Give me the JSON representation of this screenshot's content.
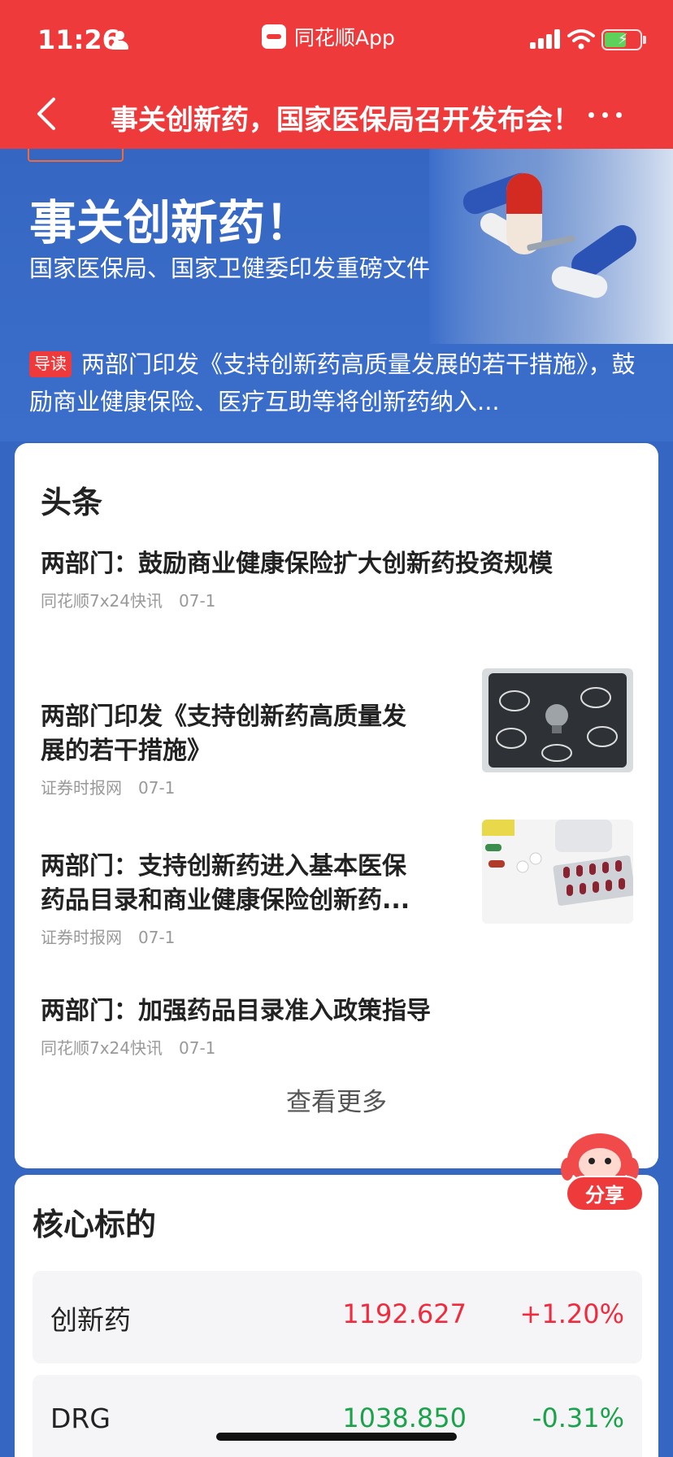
{
  "status": {
    "time": "11:26",
    "app_name": "同花顺App"
  },
  "nav": {
    "title": "事关创新药，国家医保局召开发布会！"
  },
  "hero": {
    "title": "事关创新药！",
    "subtitle": "国家医保局、国家卫健委印发重磅文件",
    "intro_badge": "导读",
    "intro_text": "两部门印发《支持创新药高质量发展的若干措施》，鼓励商业健康保险、医疗互助等将创新药纳入..."
  },
  "headlines": {
    "title": "头条",
    "items": [
      {
        "title": "两部门：鼓励商业健康保险扩大创新药投资规模",
        "source": "同花顺7x24快讯",
        "date": "07-1"
      },
      {
        "title": "两部门印发《支持创新药高质量发展的若干措施》",
        "source": "证券时报网",
        "date": "07-1"
      },
      {
        "title": "两部门：支持创新药进入基本医保药品目录和商业健康保险创新药...",
        "source": "证券时报网",
        "date": "07-1"
      },
      {
        "title": "两部门：加强药品目录准入政策指导",
        "source": "同花顺7x24快讯",
        "date": "07-1"
      }
    ],
    "more_label": "查看更多"
  },
  "share": {
    "label": "分享"
  },
  "core": {
    "title": "核心标的",
    "rows": [
      {
        "name": "创新药",
        "value": "1192.627",
        "change": "+1.20%"
      },
      {
        "name": "DRG",
        "value": "1038.850",
        "change": "-0.31%"
      }
    ]
  },
  "colors": {
    "brand_red": "#ef3a3c",
    "background_blue": "#3567c2",
    "up": "#ef2b3d",
    "down": "#1aa34a"
  },
  "icons": [
    "person-icon",
    "signal-icon",
    "wifi-icon",
    "battery-icon",
    "back-icon",
    "more-icon"
  ]
}
